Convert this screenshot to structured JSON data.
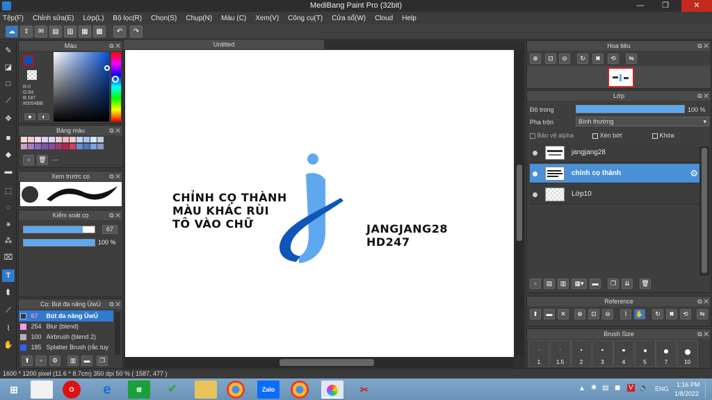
{
  "window": {
    "title": "MediBang Paint Pro (32bit)",
    "minimize": "—",
    "maximize": "❐",
    "close": "✕"
  },
  "menu": [
    "Tệp(F)",
    "Chỉnh sửa(E)",
    "Lớp(L)",
    "Bộ lọc(R)",
    "Chọn(S)",
    "Chụp(N)",
    "Màu (C)",
    "Xem(V)",
    "Công cụ(T)",
    "Cửa sổ(W)",
    "Cloud",
    "Help"
  ],
  "canvas": {
    "tab_title": "Untitled"
  },
  "artwork": {
    "left_text": [
      "CHỈNH CỌ THÀNH",
      "MÀU KHÁC RÙI",
      "TÔ VÀO CHỮ"
    ],
    "right_text": [
      "JANGJANG28",
      "HD247"
    ],
    "colors": {
      "light_blue": "#5fa8f0",
      "dark_blue": "#0e56b8"
    }
  },
  "color_panel": {
    "title": "Màu",
    "r": "R:0",
    "g": "G:84",
    "b": "B:187",
    "hex": "#0054BB",
    "primary_color": "#0054BB"
  },
  "palette_panel": {
    "title": "Bảng màu",
    "value": "---"
  },
  "preview_panel": {
    "title": "Xem trước cọ"
  },
  "brush_control": {
    "title": "Kiểm soát cọ",
    "size": "67",
    "opacity": "100 %"
  },
  "brush_list": {
    "title": "Cọ: Bút đa năng ÙwÚ",
    "items": [
      {
        "size": "67",
        "name": "Bút đa năng ÙwÚ",
        "color": "#1f3b6a"
      },
      {
        "size": "254",
        "name": "Blur (blend)",
        "color": "#ff9aea"
      },
      {
        "size": "100",
        "name": "Airbrush (blend 2)",
        "color": "#b0b0b0"
      },
      {
        "size": "185",
        "name": "Splatter Brush (rắc tuy",
        "color": "#3060ff"
      }
    ]
  },
  "navigator": {
    "title": "Hoa tiêu"
  },
  "layer_panel": {
    "title": "Lớp",
    "opacity_label": "Độ trong",
    "opacity_value": "100 %",
    "blend_label": "Pha trộn",
    "blend_value": "Bình thường",
    "protect_alpha": "Bảo vệ alpha",
    "clipping": "Xén bớt",
    "lock": "Khóa",
    "layers": [
      {
        "name": "jangjang28",
        "selected": false
      },
      {
        "name": "chỉnh cọ thành",
        "selected": true
      },
      {
        "name": "Lớp10",
        "selected": false
      }
    ]
  },
  "reference_panel": {
    "title": "Reference"
  },
  "brush_size_panel": {
    "title": "Brush Size",
    "sizes": [
      "1",
      "1.5",
      "2",
      "3",
      "4",
      "5",
      "7",
      "10"
    ]
  },
  "status": {
    "text": "1600 * 1200 pixel   (11.6 * 8.7cm)   350 dpi   50 %   ( 1587, 477 )"
  },
  "taskbar": {
    "lang": "ENG",
    "time": "1:16 PM",
    "date": "1/8/2022",
    "apps": [
      "start",
      "file",
      "opera",
      "ie",
      "store",
      "bitdefender",
      "explorer",
      "chrome",
      "zalo",
      "chrome-alt",
      "medibang",
      "paint-tool"
    ]
  }
}
